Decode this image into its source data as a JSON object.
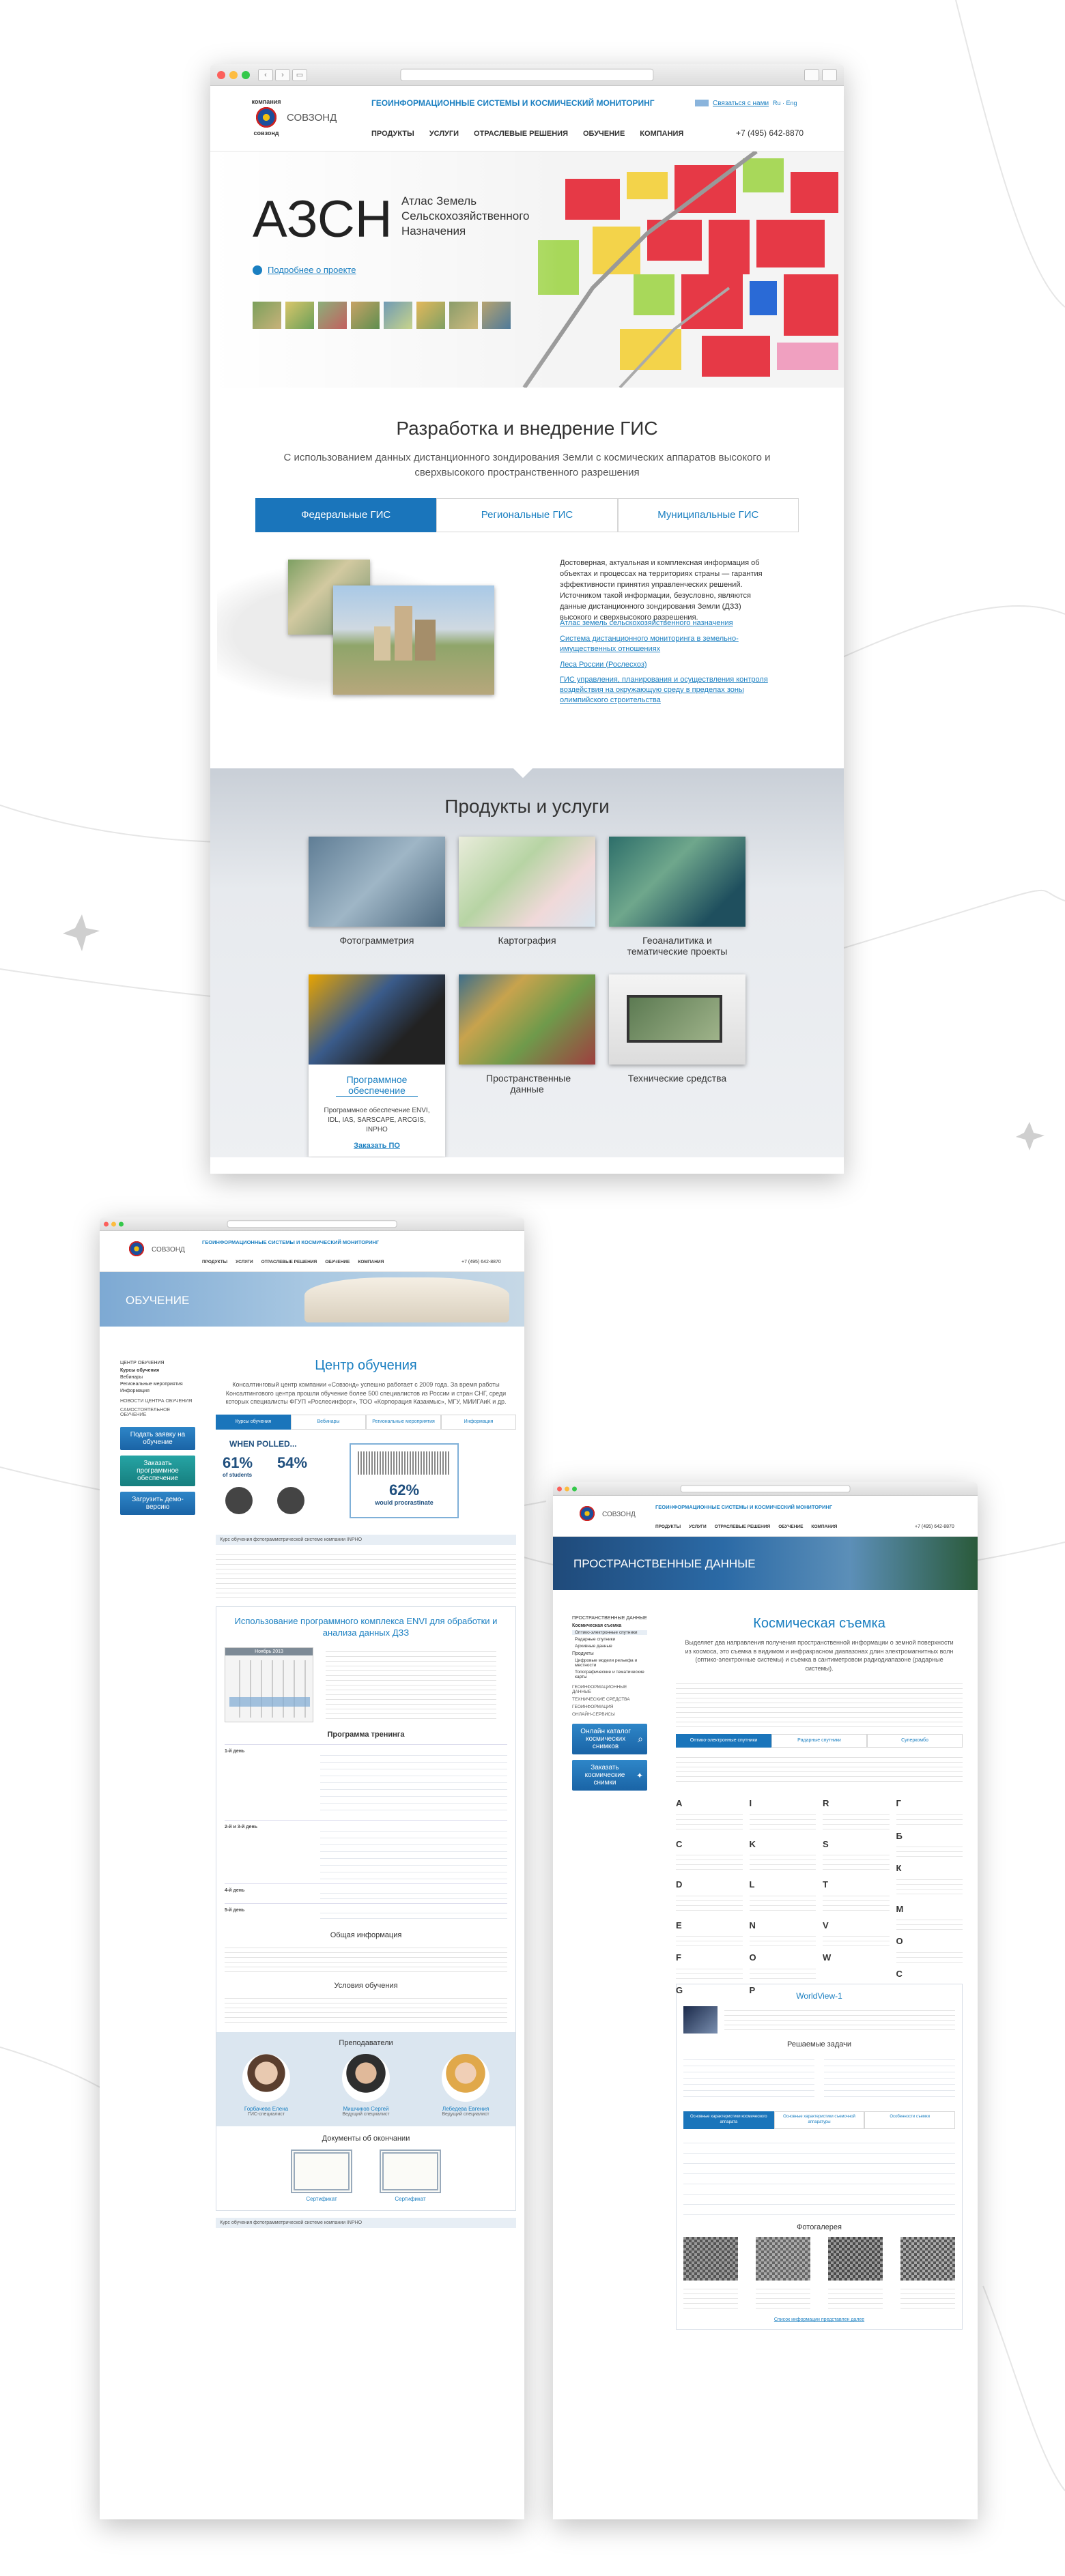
{
  "colors": {
    "accent": "#1a75bb",
    "link": "#1a7fc1",
    "bg_grey": "#dfe3e8"
  },
  "site": {
    "brand_upper": "компания",
    "brand_mid": "СОВЗОНД",
    "brand_lower": "совзонд",
    "tagline": "ГЕОИНФОРМАЦИОННЫЕ СИСТЕМЫ И КОСМИЧЕСКИЙ МОНИТОРИНГ",
    "contact": "Связаться с нами",
    "lang_ru": "Ru",
    "lang_en": "Eng",
    "phone": "+7 (495) 642-8870",
    "nav": [
      "ПРОДУКТЫ",
      "УСЛУГИ",
      "ОТРАСЛЕВЫЕ РЕШЕНИЯ",
      "ОБУЧЕНИЕ",
      "КОМПАНИЯ"
    ]
  },
  "main": {
    "hero": {
      "abbr": "АЗСН",
      "title": "Атлас Земель Сельскохозяйственного Назначения",
      "more": "Подробнее о проекте"
    },
    "gis": {
      "title": "Разработка и внедрение ГИС",
      "subtitle": "С использованием данных дистанционного зондирования Земли с космических аппаратов высокого и сверхвысокого пространственного разрешения",
      "tabs": [
        "Федеральные ГИС",
        "Региональные ГИС",
        "Муниципальные ГИС"
      ],
      "text": "Достоверная, актуальная и комплексная информация об объектах и процессах на территориях страны — гарантия эффективности принятия управленческих решений. Источником такой информации, безусловно, являются данные дистанционного зондирования Земли (ДЗЗ) высокого и сверхвысокого разрешения.",
      "links": [
        "Атлас земель сельскохозяйственного назначения",
        "Система дистанционного мониторинга в земельно-имущественных отношениях",
        "Леса России (Рослесхоз)",
        "ГИС управления, планирования и осуществления контроля воздействия на окружающую среду в пределах зоны олимпийского строительства"
      ]
    },
    "products": {
      "title": "Продукты и услуги",
      "items": [
        "Фотограмметрия",
        "Картография",
        "Геоаналитика и тематические проекты",
        "Программное обеспечение",
        "Пространственные данные",
        "Технические средства"
      ],
      "software_text": "Программное обеспечение ENVI, IDL, IAS, SARSCAPE, ARCGIS, INPHO",
      "software_link": "Заказать ПО"
    }
  },
  "left": {
    "banner": "ОБУЧЕНИЕ",
    "side": [
      "ЦЕНТР ОБУЧЕНИЯ",
      "Курсы обучения",
      "Вебинары",
      "Региональные мероприятия",
      "Информация",
      "НОВОСТИ ЦЕНТРА ОБУЧЕНИЯ",
      "САМОСТОЯТЕЛЬНОЕ ОБУЧЕНИЕ"
    ],
    "side_buttons": [
      "Подать заявку на обучение",
      "Заказать программное обеспечение",
      "Загрузить демо-версию"
    ],
    "title": "Центр обучения",
    "intro": "Консалтинговый центр компании «Совзонд» успешно работает с 2009 года. За время работы Консалтингового центра прошли обучение более 500 специалистов из России и стран СНГ, среди которых специалисты ФГУП «Рослесинфорг», ТОО «Корпорация Казакмыс», МГУ, МИИГАиК и др.",
    "tabs": [
      "Курсы обучения",
      "Вебинары",
      "Региональные мероприятия",
      "Информация"
    ],
    "poll": {
      "head": "WHEN POLLED...",
      "p1": "61%",
      "p2": "54%",
      "of": "of students",
      "p3": "62%",
      "p3_text": "would procrastinate"
    },
    "course_crumb": "Курс обучения фотограмметрической системе компании INPHO",
    "envi_title": "Использование программного комплекса ENVI для обработки и анализа данных ДЗЗ",
    "calendar_month": "Ноябрь 2013",
    "program_title": "Программа тренинга",
    "program_days": [
      "1-й день",
      "2-й и 3-й день",
      "4-й день",
      "5-й день"
    ],
    "general_title": "Общая информация",
    "conditions_title": "Условия обучения",
    "teachers_title": "Преподаватели",
    "teachers": [
      {
        "name": "Горбачева Елена",
        "role": "ГИС-специалист"
      },
      {
        "name": "Мишчиков Сергей",
        "role": "Ведущий специалист"
      },
      {
        "name": "Лебедева Евгения",
        "role": "Ведущий специалист"
      }
    ],
    "docs_title": "Документы об окончании",
    "docs": [
      "Сертификат",
      "Сертификат"
    ],
    "footer_link": "Курс обучения фотограмметрической системе компании INPHO"
  },
  "right": {
    "banner": "ПРОСТРАНСТВЕННЫЕ ДАННЫЕ",
    "side": [
      "ПРОСТРАНСТВЕННЫЕ ДАННЫЕ",
      "Космическая съемка",
      "Оптико-электронные спутники",
      "Радарные спутники",
      "Архивные данные",
      "Продукты",
      "Цифровые модели рельефа и местности",
      "Топографические и тематические карты",
      "ГЕОИНФОРМАЦИОННЫЕ ДАННЫЕ",
      "ТЕХНИЧЕСКИЕ СРЕДСТВА",
      "ГЕОИНФОРМАЦИЯ",
      "ОНЛАЙН-СЕРВИСЫ"
    ],
    "side_buttons": [
      "Онлайн каталог космических снимков",
      "Заказать космические снимки"
    ],
    "title": "Космическая съемка",
    "intro": "Выделяет два направления получения пространственной информации о земной поверхности из космоса, это съемка в видимом и инфракрасном диапазонах длин электромагнитных волн (оптико-электронные системы) и съемка в сантиметровом радиодиапазоне (радарные системы).",
    "tabs": [
      "Оптико-электронные спутники",
      "Радарные спутники",
      "Суперкомбо"
    ],
    "alphabet": [
      "A",
      "C",
      "D",
      "E",
      "F",
      "G",
      "I",
      "K",
      "L",
      "N",
      "O",
      "P",
      "Q",
      "R",
      "S",
      "T",
      "V",
      "W",
      "Г",
      "Б",
      "К",
      "M",
      "О",
      "Р",
      "С"
    ],
    "wv_title": "WorldView-1",
    "tasks_title": "Решаемые задачи",
    "char_tabs": [
      "Основные характеристики космического аппарата",
      "Основные характеристики съемочной аппаратуры",
      "Особенности съемки"
    ],
    "gallery_title": "Фотогалерея",
    "footer_link": "Список информации представлен далее"
  }
}
